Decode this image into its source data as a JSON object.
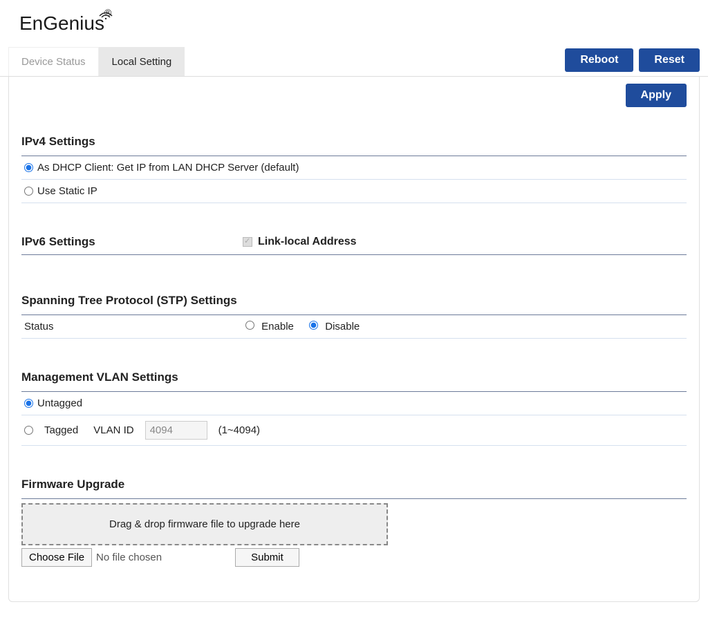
{
  "logo": {
    "text": "EnGenius"
  },
  "tabs": {
    "device_status": "Device Status",
    "local_setting": "Local Setting"
  },
  "buttons": {
    "reboot": "Reboot",
    "reset": "Reset",
    "apply": "Apply",
    "submit": "Submit",
    "choose_file": "Choose File"
  },
  "ipv4": {
    "title": "IPv4 Settings",
    "dhcp_label": "As DHCP Client: Get IP from LAN DHCP Server (default)",
    "static_label": "Use Static IP"
  },
  "ipv6": {
    "title": "IPv6 Settings",
    "link_local": "Link-local Address"
  },
  "stp": {
    "title": "Spanning Tree Protocol (STP) Settings",
    "status_label": "Status",
    "enable": "Enable",
    "disable": "Disable"
  },
  "vlan": {
    "title": "Management VLAN Settings",
    "untagged": "Untagged",
    "tagged": "Tagged",
    "vlan_id_label": "VLAN ID",
    "vlan_id_value": "4094",
    "range_hint": "(1~4094)"
  },
  "firmware": {
    "title": "Firmware Upgrade",
    "drop_text": "Drag & drop firmware file to upgrade here",
    "no_file": "No file chosen"
  }
}
